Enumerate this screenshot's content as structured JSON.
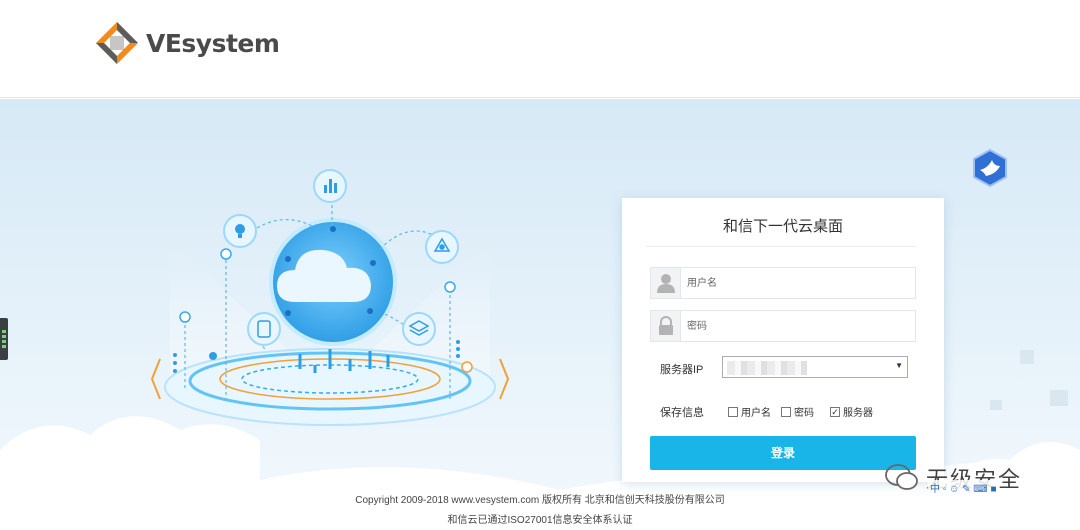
{
  "brand": {
    "name": "VEsystem",
    "colors": {
      "orange": "#f28a1c",
      "gray": "#5c5c5c",
      "accent": "#19b4e8",
      "bird": "#2f6fd6"
    }
  },
  "login": {
    "title": "和信下一代云桌面",
    "username_placeholder": "用户名",
    "password_placeholder": "密码",
    "server_label": "服务器IP",
    "server_value": "",
    "save_label": "保存信息",
    "save_options": [
      {
        "label": "用户名",
        "checked": false
      },
      {
        "label": "密码",
        "checked": false
      },
      {
        "label": "服务器",
        "checked": true
      }
    ],
    "submit_label": "登录"
  },
  "footer": {
    "copyright": "Copyright 2009-2018 www.vesystem.com 版权所有 北京和信创天科技股份有限公司",
    "certification": "和信云已通过ISO27001信息安全体系认证"
  },
  "watermark": {
    "text": "无级安全",
    "badge": "中 ◦ ☺ ✎ ⌨ ■"
  },
  "icons": [
    "vesystem-logo-icon",
    "bird-icon",
    "cloud-icon",
    "user-icon",
    "lock-icon",
    "bulb-icon",
    "chart-icon",
    "network-icon",
    "phone-icon",
    "layers-icon"
  ]
}
